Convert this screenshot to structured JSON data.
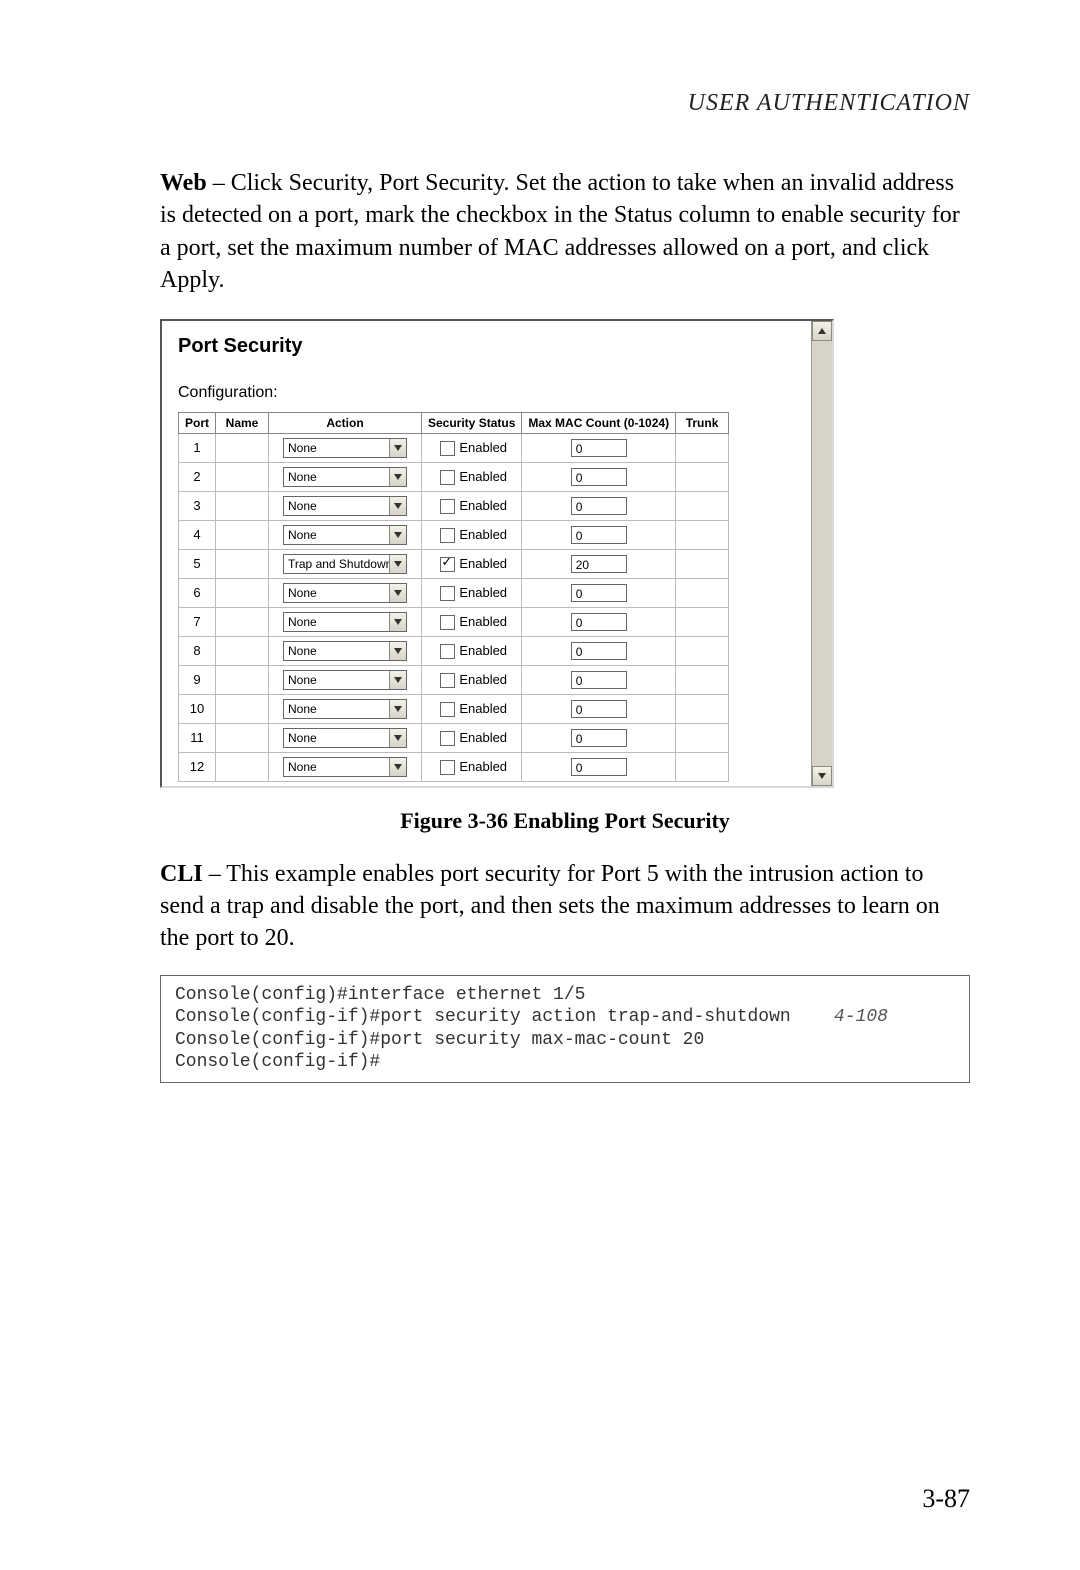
{
  "header": {
    "running_title": "USER AUTHENTICATION"
  },
  "para1": {
    "lead": "Web",
    "rest": " – Click Security, Port Security. Set the action to take when an invalid address is detected on a port, mark the checkbox in the Status column to enable security for a port, set the maximum number of MAC addresses allowed on a port, and click Apply."
  },
  "panel": {
    "title": "Port Security",
    "config_label": "Configuration:",
    "headers": {
      "port": "Port",
      "name": "Name",
      "action": "Action",
      "status": "Security Status",
      "maxmac": "Max MAC Count (0-1024)",
      "trunk": "Trunk"
    },
    "status_word": "Enabled",
    "rows": [
      {
        "port": "1",
        "name": "",
        "action": "None",
        "checked": false,
        "max": "0",
        "trunk": ""
      },
      {
        "port": "2",
        "name": "",
        "action": "None",
        "checked": false,
        "max": "0",
        "trunk": ""
      },
      {
        "port": "3",
        "name": "",
        "action": "None",
        "checked": false,
        "max": "0",
        "trunk": ""
      },
      {
        "port": "4",
        "name": "",
        "action": "None",
        "checked": false,
        "max": "0",
        "trunk": ""
      },
      {
        "port": "5",
        "name": "",
        "action": "Trap and Shutdown",
        "checked": true,
        "max": "20",
        "trunk": ""
      },
      {
        "port": "6",
        "name": "",
        "action": "None",
        "checked": false,
        "max": "0",
        "trunk": ""
      },
      {
        "port": "7",
        "name": "",
        "action": "None",
        "checked": false,
        "max": "0",
        "trunk": ""
      },
      {
        "port": "8",
        "name": "",
        "action": "None",
        "checked": false,
        "max": "0",
        "trunk": ""
      },
      {
        "port": "9",
        "name": "",
        "action": "None",
        "checked": false,
        "max": "0",
        "trunk": ""
      },
      {
        "port": "10",
        "name": "",
        "action": "None",
        "checked": false,
        "max": "0",
        "trunk": ""
      },
      {
        "port": "11",
        "name": "",
        "action": "None",
        "checked": false,
        "max": "0",
        "trunk": ""
      },
      {
        "port": "12",
        "name": "",
        "action": "None",
        "checked": false,
        "max": "0",
        "trunk": ""
      }
    ]
  },
  "figure_caption": "Figure 3-36  Enabling Port Security",
  "para2": {
    "lead": "CLI",
    "rest": " – This example enables port security for Port 5 with the intrusion action to send a trap and disable the port, and then sets the maximum addresses to learn on the port to 20."
  },
  "cli": {
    "line1": "Console(config)#interface ethernet 1/5",
    "line2": "Console(config-if)#port security action trap-and-shutdown",
    "ref2": "4-108",
    "line3": "Console(config-if)#port security max-mac-count 20",
    "line4": "Console(config-if)#"
  },
  "page_number": "3-87"
}
